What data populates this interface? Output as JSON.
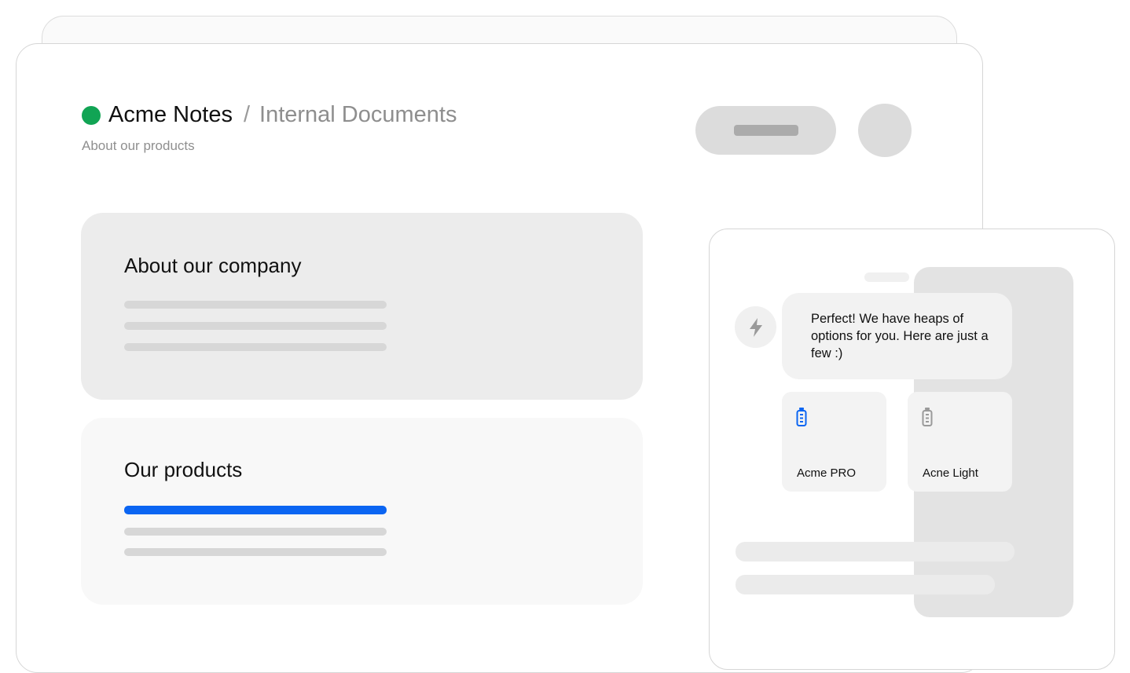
{
  "app": {
    "name": "Acme Notes",
    "breadcrumb_separator": "/",
    "breadcrumb_current": "Internal Documents",
    "subtitle": "About our products",
    "status_color": "#11a454"
  },
  "sections": [
    {
      "title": "About our company",
      "lines": 3,
      "active_line": null
    },
    {
      "title": "Our products",
      "lines": 3,
      "active_line": 0
    }
  ],
  "chat": {
    "bot_icon": "lightning-bolt-icon",
    "message": "Perfect! We have heaps of options for you. Here are just a few :)",
    "products": [
      {
        "name": "Acme PRO",
        "icon": "bottle-icon",
        "color": "#0b65f2"
      },
      {
        "name": "Acne Light",
        "icon": "bottle-icon",
        "color": "#9a9a9a"
      }
    ]
  },
  "colors": {
    "accent": "#0b65f2"
  }
}
